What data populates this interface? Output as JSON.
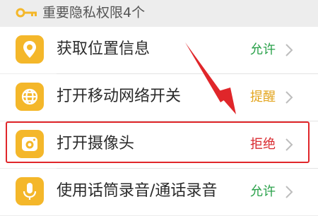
{
  "section": {
    "title": "重要隐私权限4个",
    "icon": "key-icon"
  },
  "colors": {
    "icon_bg": "#f4b72a",
    "allow": "#2aa14a",
    "remind": "#e3a51f",
    "deny": "#d9282e",
    "highlight": "#e0262a"
  },
  "permissions": [
    {
      "label": "获取位置信息",
      "status": "允许",
      "icon": "location-icon"
    },
    {
      "label": "打开移动网络开关",
      "status": "提醒",
      "icon": "globe-icon"
    },
    {
      "label": "打开摄像头",
      "status": "拒绝",
      "icon": "camera-icon"
    },
    {
      "label": "使用话筒录音/通话录音",
      "status": "允许",
      "icon": "microphone-icon"
    }
  ]
}
